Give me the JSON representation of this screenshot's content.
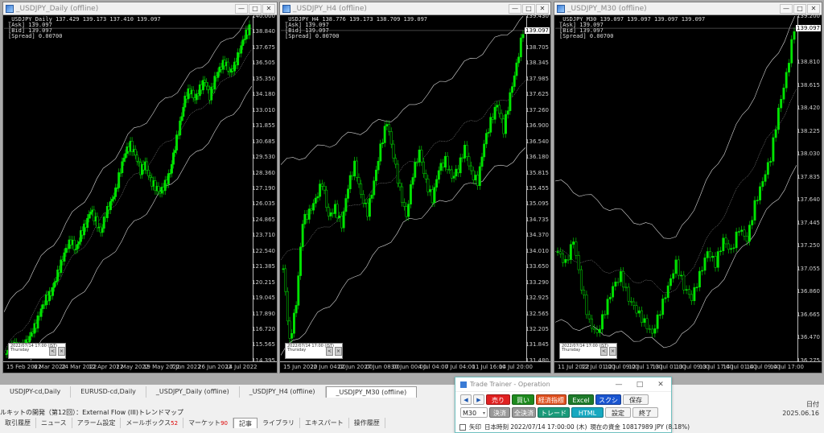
{
  "charts": [
    {
      "title": "_USDJPY_Daily (offline)",
      "info": [
        "_USDJPY_Daily 137.429 139.173 137.410 139.097",
        "[Ask] 139.097",
        "[Bid] 139.097",
        "[Spread] 0.00700"
      ],
      "ticks": [
        "140.000",
        "138.840",
        "137.675",
        "136.505",
        "135.350",
        "134.180",
        "133.010",
        "131.855",
        "130.685",
        "129.530",
        "128.360",
        "127.190",
        "126.035",
        "124.865",
        "123.710",
        "122.540",
        "121.385",
        "120.215",
        "119.045",
        "117.890",
        "116.720",
        "115.565",
        "114.395"
      ],
      "current_price": "139.097",
      "xticks": [
        "15 Feb 2022",
        "6 Mar 2022",
        "24 Mar 2022",
        "12 Apr 2022",
        "1 May 2022",
        "19 May 2022",
        "7 Jun 2022",
        "26 Jun 2022",
        "14 Jul 2022"
      ]
    },
    {
      "title": "_USDJPY_H4 (offline)",
      "info": [
        "_USDJPY_H4 138.776 139.173 138.709 139.097",
        "[Ask] 139.097",
        "[Bid] 139.097",
        "[Spread] 0.00700"
      ],
      "ticks": [
        "139.430",
        "139.097",
        "138.705",
        "138.345",
        "137.985",
        "137.625",
        "137.260",
        "136.900",
        "136.540",
        "136.180",
        "135.815",
        "135.455",
        "135.095",
        "134.735",
        "134.370",
        "134.010",
        "133.650",
        "133.290",
        "132.925",
        "132.565",
        "132.205",
        "131.845",
        "131.480"
      ],
      "current_price": "139.097",
      "xticks": [
        "15 Jun 2022",
        "20 Jun 04:00",
        "22 Jun 20:00",
        "27 Jun 08:00",
        "30 Jun 00:00",
        "4 Jul 04:00",
        "7 Jul 04:00",
        "11 Jul 16:00",
        "14 Jul 20:00"
      ]
    },
    {
      "title": "_USDJPY_M30 (offline)",
      "info": [
        "_USDJPY_M30 139.097 139.097 139.097 139.097",
        "[Ask] 139.097",
        "[Bid] 139.097",
        "[Spread] 0.00700"
      ],
      "ticks": [
        "139.200",
        "139.097",
        "138.810",
        "138.615",
        "138.420",
        "138.225",
        "138.030",
        "137.835",
        "137.640",
        "137.445",
        "137.250",
        "137.055",
        "136.860",
        "136.665",
        "136.470",
        "136.275"
      ],
      "current_price": "139.097",
      "xticks": [
        "11 Jul 2022",
        "12 Jul 01:00",
        "12 Jul 09:00",
        "12 Jul 17:00",
        "13 Jul 01:00",
        "13 Jul 09:00",
        "13 Jul 17:00",
        "14 Jul 01:00",
        "14 Jul 09:00",
        "14 Jul 17:00"
      ]
    }
  ],
  "chart_data": [
    {
      "type": "candlestick",
      "title": "_USDJPY_Daily (offline)",
      "ylim": [
        114.395,
        140.0
      ],
      "x_range": [
        "15 Feb 2022",
        "14 Jul 2022"
      ],
      "close_path": [
        114.9,
        115.3,
        115.6,
        115.2,
        115.7,
        116.4,
        117.1,
        118.2,
        119.0,
        119.4,
        120.5,
        121.6,
        122.7,
        123.3,
        122.6,
        123.8,
        124.5,
        125.6,
        124.8,
        123.9,
        125.3,
        126.1,
        127.0,
        128.6,
        129.9,
        130.4,
        129.7,
        128.5,
        129.0,
        127.8,
        127.3,
        126.9,
        127.5,
        128.4,
        130.3,
        132.0,
        133.9,
        134.5,
        133.8,
        134.6,
        135.2,
        134.0,
        135.3,
        136.1,
        136.6,
        135.8,
        136.3,
        137.4,
        138.5,
        139.1
      ],
      "bands": {
        "upper_start": 118.0,
        "upper_mid": 131.0,
        "upper_end": 140.0,
        "lower_start": 112.0,
        "lower_mid": 124.0,
        "lower_end": 134.5
      }
    },
    {
      "type": "candlestick",
      "title": "_USDJPY_H4 (offline)",
      "ylim": [
        131.48,
        139.43
      ],
      "x_range": [
        "15 Jun 2022",
        "14 Jul 20:00"
      ],
      "close_path": [
        133.6,
        131.9,
        132.8,
        134.7,
        134.9,
        135.2,
        135.6,
        134.8,
        135.0,
        134.6,
        135.5,
        136.0,
        135.3,
        134.9,
        135.6,
        136.4,
        137.0,
        136.2,
        135.4,
        134.8,
        135.8,
        136.3,
        135.6,
        135.2,
        135.9,
        136.1,
        135.7,
        135.9,
        136.4,
        135.8,
        135.6,
        136.5,
        137.0,
        137.4,
        136.8,
        137.6,
        138.3,
        139.1
      ],
      "bands": {
        "upper_start": 136.0,
        "upper_mid": 137.2,
        "upper_end": 139.4,
        "lower_start": 131.6,
        "lower_mid": 134.6,
        "lower_end": 136.3
      }
    },
    {
      "type": "candlestick",
      "title": "_USDJPY_M30 (offline)",
      "ylim": [
        136.275,
        139.2
      ],
      "x_range": [
        "11 Jul 2022",
        "14 Jul 17:00"
      ],
      "close_path": [
        137.2,
        137.1,
        137.3,
        136.9,
        136.6,
        136.5,
        136.7,
        136.9,
        137.0,
        136.8,
        136.7,
        136.6,
        136.5,
        136.7,
        136.9,
        137.1,
        136.9,
        136.8,
        137.0,
        137.2,
        137.1,
        137.3,
        137.2,
        137.4,
        137.3,
        137.6,
        137.8,
        138.0,
        138.4,
        138.7,
        139.1
      ],
      "bands": {
        "upper_start": 137.8,
        "upper_mid": 137.3,
        "upper_end": 139.2,
        "lower_start": 136.6,
        "lower_mid": 136.4,
        "lower_end": 137.9
      }
    }
  ],
  "tabs": [
    "USDJPY-cd,Daily",
    "EURUSD-cd,Daily",
    "_USDJPY_Daily (offline)",
    "_USDJPY_H4 (offline)",
    "_USDJPY_M30 (offline)"
  ],
  "active_tab": 4,
  "news_line": "ルキットの開発（第12回）：External Flow (III)トレンドマップ",
  "terminal_tabs": [
    {
      "label": "取引履歴",
      "badge": ""
    },
    {
      "label": "ニュース",
      "badge": ""
    },
    {
      "label": "アラーム設定",
      "badge": ""
    },
    {
      "label": "メールボックス",
      "badge": "52"
    },
    {
      "label": "マーケット",
      "badge": "90"
    },
    {
      "label": "記事",
      "badge": ""
    },
    {
      "label": "ライブラリ",
      "badge": ""
    },
    {
      "label": "エキスパート",
      "badge": ""
    },
    {
      "label": "操作履歴",
      "badge": ""
    }
  ],
  "right_label": "日付",
  "right_date": "2025.06.16",
  "dialog": {
    "title": "Trade Trainer - Operation",
    "row1": [
      "◀",
      "▶",
      "売り",
      "買い",
      "経済指標",
      "Excel",
      "スクショ",
      "保存"
    ],
    "row2_select": "M30",
    "row2": [
      "決済",
      "全決済",
      "トレード",
      "HTML",
      "設定",
      "終了"
    ],
    "status_check_label": "矢印",
    "status_time": "日本時刻 2022/07/14 17:00:00 (木)",
    "status_funds": "現在の資金 10817989 JPY (8.18%)"
  },
  "colors": {
    "sell": "#e02020",
    "buy": "#1e8a1e",
    "indicator": "#e0501e",
    "excel": "#1e7a2a",
    "screenshot": "#1a55d0",
    "settle": "#9a9a9a",
    "trade": "#1a9a7a",
    "html": "#17a8c0",
    "bull": "#00e400",
    "band": "#d8d8d8"
  }
}
